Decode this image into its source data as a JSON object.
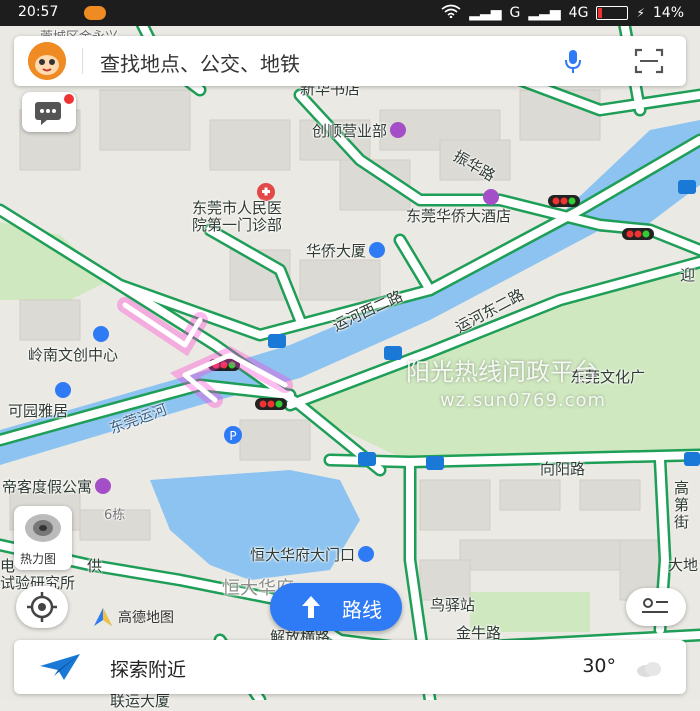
{
  "status_bar": {
    "time": "20:57",
    "signal": "G",
    "network": "4G",
    "battery": "14%"
  },
  "search": {
    "placeholder": "查找地点、公交、地铁"
  },
  "map": {
    "labels": {
      "top_left_street": "莞城区金永兴",
      "book_store": "新华书店",
      "chuangshun": "创顺营业部",
      "zhenhua_rd": "振华路",
      "hospital_l1": "东莞市人民医",
      "hospital_l2": "院第一门诊部",
      "huaqiao_hotel": "东莞华侨大酒店",
      "huaqiao_tower": "华侨大厦",
      "yunhe_west": "运河西二路",
      "yunhe_east": "运河东二路",
      "lingnan": "岭南文创中心",
      "keyuan": "可园雅居",
      "dongguan_canal": "东莞运河",
      "dijie": "帝客度假公寓",
      "building6": "6栋",
      "xiangyang_rd": "向阳路",
      "gaodi_l1": "高",
      "gaodi_l2": "第",
      "gaodi_l3": "街",
      "hengda_gate": "恒大华府大门口",
      "hengda_area": "恒大华府",
      "dadi": "大地",
      "jiefang_rd": "解放横路",
      "jinniu_rd": "金牛路",
      "postal": "鸟驿站",
      "research_l1": "电",
      "research_l1b": "供",
      "research_l2": "试验研究所",
      "bottom_partial": "联运大厦",
      "culture_partial": "东莞文化广",
      "right_edge": "迎"
    }
  },
  "controls": {
    "heatmap_label": "热力图",
    "logo_text": "高德地图",
    "route_label": "路线",
    "explore_label": "探索附近",
    "temperature": "30°"
  },
  "watermark": {
    "title": "阳光热线问政平台",
    "url": "wz.sun0769.com"
  },
  "colors": {
    "road_border": "#1e9e57",
    "water": "#8cc3f0",
    "park": "#cfe8bf",
    "accent": "#2f7bf5",
    "highlight": "#ff2fd0"
  }
}
